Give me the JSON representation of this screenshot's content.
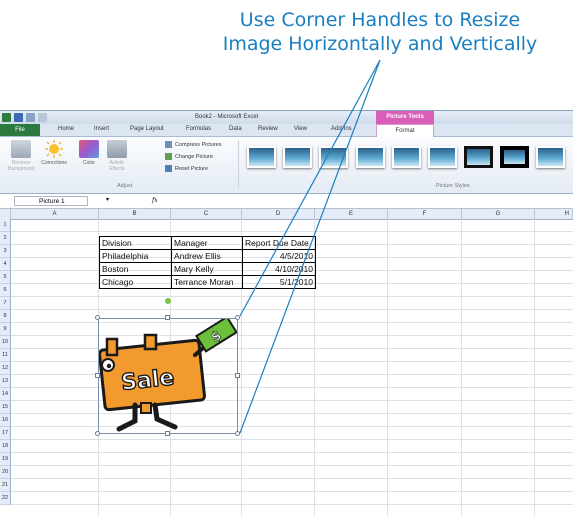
{
  "callout": {
    "line1": "Use Corner Handles to Resize",
    "line2": "Image Horizontally and Vertically"
  },
  "window": {
    "title": "Book2 - Microsoft Excel",
    "context_tab_group": "Picture Tools"
  },
  "tabs": [
    "File",
    "Home",
    "Insert",
    "Page Layout",
    "Formulas",
    "Data",
    "Review",
    "View",
    "Add-Ins",
    "Format"
  ],
  "ribbon": {
    "remove_background": "Remove Background",
    "corrections": "Corrections",
    "color": "Color",
    "artistic_effects": "Artistic Effects",
    "compress_pictures": "Compress Pictures",
    "change_picture": "Change Picture",
    "reset_picture": "Reset Picture",
    "adjust_group": "Adjust",
    "picture_styles_group": "Picture Styles"
  },
  "formula_bar": {
    "name_box": "Picture 1",
    "fx_label": "fx",
    "formula": ""
  },
  "columns": [
    "A",
    "B",
    "C",
    "D",
    "E",
    "F",
    "G",
    "H"
  ],
  "rows": [
    "1",
    "2",
    "3",
    "4",
    "5",
    "6",
    "7",
    "8",
    "9",
    "10",
    "11",
    "12",
    "13",
    "14",
    "15",
    "16",
    "17",
    "18",
    "19",
    "20",
    "21",
    "22"
  ],
  "table": {
    "headers": [
      "Division",
      "Manager",
      "Report Due Date"
    ],
    "rows": [
      [
        "Philadelphia",
        "Andrew Ellis",
        "4/5/2010"
      ],
      [
        "Boston",
        "Mary Kelly",
        "4/10/2010"
      ],
      [
        "Chicago",
        "Terrance Moran",
        "5/1/2010"
      ]
    ]
  },
  "clipart": {
    "sign_text": "Sale",
    "bill_text": "$"
  },
  "colors": {
    "callout_text": "#1a7fc0",
    "picture_tools": "#d85eb8",
    "file_tab": "#2c7a3f",
    "sign_orange": "#f39a2e",
    "bill_green": "#6bbf3a"
  }
}
